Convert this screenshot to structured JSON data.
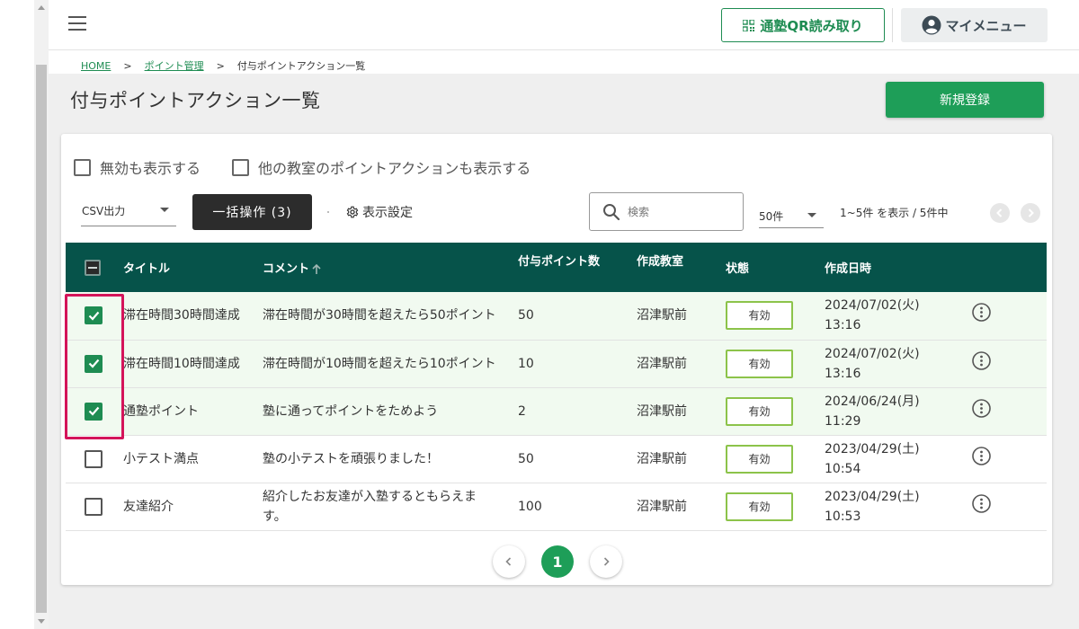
{
  "header": {
    "qr_label": "通塾QR読み取り",
    "menu_label": "マイメニュー"
  },
  "breadcrumb": {
    "home": "HOME",
    "sep1": ">",
    "points": "ポイント管理",
    "sep2": ">",
    "current": "付与ポイントアクション一覧"
  },
  "page": {
    "title": "付与ポイントアクション一覧",
    "new_button": "新規登録"
  },
  "filters": {
    "show_inactive": "無効も表示する",
    "show_other_rooms": "他の教室のポイントアクションも表示する"
  },
  "toolbar": {
    "csv_label": "CSV出力",
    "bulk_label": "一括操作 (3)",
    "display_settings": "表示設定",
    "search_placeholder": "検索",
    "per_page": "50件",
    "range": "1~5件 を表示 / 5件中"
  },
  "table": {
    "headers": {
      "title": "タイトル",
      "comment": "コメント",
      "points": "付与ポイント数",
      "room": "作成教室",
      "status": "状態",
      "created": "作成日時"
    },
    "rows": [
      {
        "checked": true,
        "title": "滞在時間30時間達成",
        "comment": "滞在時間が30時間を超えたら50ポイント",
        "points": "50",
        "room": "沼津駅前",
        "status": "有効",
        "date": "2024/07/02(火)",
        "time": "13:16"
      },
      {
        "checked": true,
        "title": "滞在時間10時間達成",
        "comment": "滞在時間が10時間を超えたら10ポイント",
        "points": "10",
        "room": "沼津駅前",
        "status": "有効",
        "date": "2024/07/02(火)",
        "time": "13:16"
      },
      {
        "checked": true,
        "title": "通塾ポイント",
        "comment": "塾に通ってポイントをためよう",
        "points": "2",
        "room": "沼津駅前",
        "status": "有効",
        "date": "2024/06/24(月)",
        "time": "11:29"
      },
      {
        "checked": false,
        "title": "小テスト満点",
        "comment": "塾の小テストを頑張りました！",
        "points": "50",
        "room": "沼津駅前",
        "status": "有効",
        "date": "2023/04/29(土)",
        "time": "10:54"
      },
      {
        "checked": false,
        "title": "友達紹介",
        "comment": "紹介したお友達が入塾するともらえます。",
        "points": "100",
        "room": "沼津駅前",
        "status": "有効",
        "date": "2023/04/29(土)",
        "time": "10:53"
      }
    ]
  },
  "pagination": {
    "current_page": "1"
  },
  "colors": {
    "brand_green": "#1e9e58",
    "table_header": "#06534a",
    "highlight": "#d4145a",
    "status_border": "#8cc34a"
  },
  "icons": [
    "hamburger-icon",
    "qr-code-icon",
    "user-circle-icon",
    "search-icon",
    "gear-icon",
    "sort-up-arrow-icon",
    "check-icon",
    "more-vertical-icon",
    "chevron-left-icon",
    "chevron-right-icon"
  ]
}
